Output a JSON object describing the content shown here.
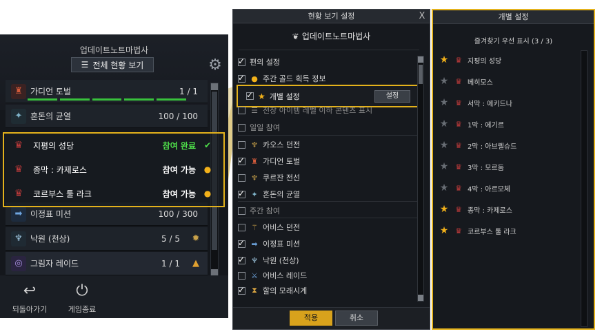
{
  "left": {
    "title": "업데이트노트마법사",
    "all_status_button": "전체 현황 보기",
    "list_icon": "list-icon",
    "gear_icon": "gear-icon",
    "rows_top": [
      {
        "name": "가디언 토벌",
        "value": "1 / 1",
        "icon": "guardian-icon",
        "bars": 5
      },
      {
        "name": "혼돈의 균열",
        "value": "100 / 100",
        "icon": "chaos-icon"
      }
    ],
    "highlight_rows": [
      {
        "name": "지평의 성당",
        "status": "참여 완료",
        "done": true,
        "icon": "raid-emblem-icon",
        "mark": "check-icon"
      },
      {
        "name": "종막 : 카제로스",
        "status": "참여 가능",
        "done": false,
        "icon": "raid-emblem-icon",
        "mark": "gold-icon"
      },
      {
        "name": "코르부스 툴 라크",
        "status": "참여 가능",
        "done": false,
        "icon": "raid-emblem-icon",
        "mark": "gold-icon"
      }
    ],
    "rows_bottom": [
      {
        "name": "이정표 미션",
        "value": "100 / 300",
        "icon": "milestone-icon"
      },
      {
        "name": "낙원 (천상)",
        "value": "5  /  5",
        "icon": "paradise-icon",
        "ext": "sun-icon"
      },
      {
        "name": "그림자 레이드",
        "value": "1  /  1",
        "icon": "shadow-icon",
        "ext": "chevron-up-icon"
      }
    ],
    "back_label": "되돌아가기",
    "exit_label": "게임종료"
  },
  "middle": {
    "title": "현황 보기 설정",
    "close": "X",
    "brand": "업데이트노트마법사",
    "rows": [
      {
        "label": "편의 설정",
        "checked": true,
        "icon": ""
      },
      {
        "label": "주간 골드 획득 정보",
        "checked": true,
        "icon": "gold-coin-icon"
      },
      {
        "label": "전장 아이템 레벨 이하 콘텐츠 표시",
        "checked": false,
        "icon": "list-icon"
      },
      {
        "label": "일일 참여",
        "checked": false,
        "icon": ""
      },
      {
        "label": "카오스 던전",
        "checked": false,
        "icon": "chaos-dungeon-icon"
      },
      {
        "label": "가디언 토벌",
        "checked": true,
        "icon": "guardian-icon"
      },
      {
        "label": "쿠르잔 전선",
        "checked": false,
        "icon": "kurzan-icon"
      },
      {
        "label": "혼돈의 균열",
        "checked": true,
        "icon": "chaos-icon"
      },
      {
        "label": "주간 참여",
        "checked": false,
        "icon": ""
      },
      {
        "label": "어비스 던전",
        "checked": false,
        "icon": "abyss-icon"
      },
      {
        "label": "이정표 미션",
        "checked": true,
        "icon": "milestone-icon"
      },
      {
        "label": "낙원 (천상)",
        "checked": true,
        "icon": "paradise-icon"
      },
      {
        "label": "어비스 레이드",
        "checked": false,
        "icon": "abyss-raid-icon"
      },
      {
        "label": "할의 모래시계",
        "checked": true,
        "icon": "hourglass-icon"
      }
    ],
    "individual": {
      "label": "개별 설정",
      "button": "설정",
      "checked": true
    },
    "apply": "적용",
    "cancel": "취소"
  },
  "right": {
    "title": "개별 설정",
    "subtitle": "즐겨찾기 우선 표시 (3 / 3)",
    "items": [
      {
        "label": "지평의 성당",
        "fav": true
      },
      {
        "label": "베히모스",
        "fav": false
      },
      {
        "label": "서막 : 에키드나",
        "fav": false
      },
      {
        "label": "1막 : 에기르",
        "fav": false
      },
      {
        "label": "2막 : 아브렐슈드",
        "fav": false
      },
      {
        "label": "3막 : 모르둠",
        "fav": false
      },
      {
        "label": "4막 : 아르모체",
        "fav": false
      },
      {
        "label": "종막 : 카제로스",
        "fav": true
      },
      {
        "label": "코르부스 툴 라크",
        "fav": true
      }
    ]
  },
  "colors": {
    "accent": "#e4b21b",
    "done": "#4fe04a",
    "bar": "#38c23c",
    "apply": "#d8a21c"
  }
}
